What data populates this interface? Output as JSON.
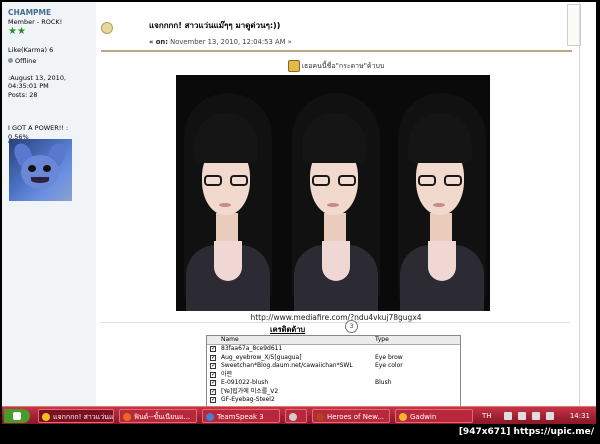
{
  "profile": {
    "username": "CHAMPME",
    "rank": "Member - ROCK!",
    "stars": "★★",
    "karma": "Like(Karma) 6",
    "status": "Offline",
    "date": ":August 13, 2010, 04:35:01 PM",
    "posts": "Posts: 28",
    "power_label": "I GOT A POWER!! :",
    "power_percent": "0.56%",
    "power_fraction": 0.0056
  },
  "post": {
    "title": "แจกกกก! สาวแว่นแม๊ๆๆ มาดูด่วนๆ:))",
    "date_prefix": "« on:",
    "date_value": "November 13, 2010, 12:04:53 AM »",
    "caption": "เธอคนนี้ชื่อ\"กระดาษ\"ค้าบบ",
    "link": "http://www.mediafire.com/?ndu4vkuj78gugx4",
    "credit_title": "เครดิตด้าบ",
    "credit_badge": "3"
  },
  "table": {
    "headers": [
      "Name",
      "Type"
    ],
    "rows": [
      {
        "name": "83faa67a_8ce9d611",
        "type": ""
      },
      {
        "name": "Aug_eyebrow_X/5[guagua]",
        "type": "Eye brow"
      },
      {
        "name": "Sweetchan*Blog.daum.net/cawaiichan*SWL",
        "type": "Eye color"
      },
      {
        "name": "아련",
        "type": ""
      },
      {
        "name": "E-091022-blush",
        "type": "Blush"
      },
      {
        "name": "[Ye]립가에 미소를_V2",
        "type": ""
      },
      {
        "name": "GF-Eyebag-Steel2",
        "type": ""
      }
    ]
  },
  "taskbar": {
    "items": [
      {
        "label": "แจกกกก! สาวแว่นแม...",
        "color": "#f0c020"
      },
      {
        "label": "ฟินด์--ขั้นเนียนแ...",
        "color": "#e86a1c"
      },
      {
        "label": "TeamSpeak 3",
        "color": "#4a7fd0"
      },
      {
        "label": "",
        "color": "#cccccc"
      },
      {
        "label": "Heroes of New...",
        "color": "#aa4422"
      },
      {
        "label": "Gadwin",
        "color": "#f2b632"
      }
    ],
    "language": "TH",
    "clock": "14:31"
  },
  "footer": {
    "watermark": "[947x671] https://upic.me/"
  },
  "colors": {
    "taskbar": "#9c1f30",
    "username": "#476c8e",
    "separator": "#b9a888"
  }
}
